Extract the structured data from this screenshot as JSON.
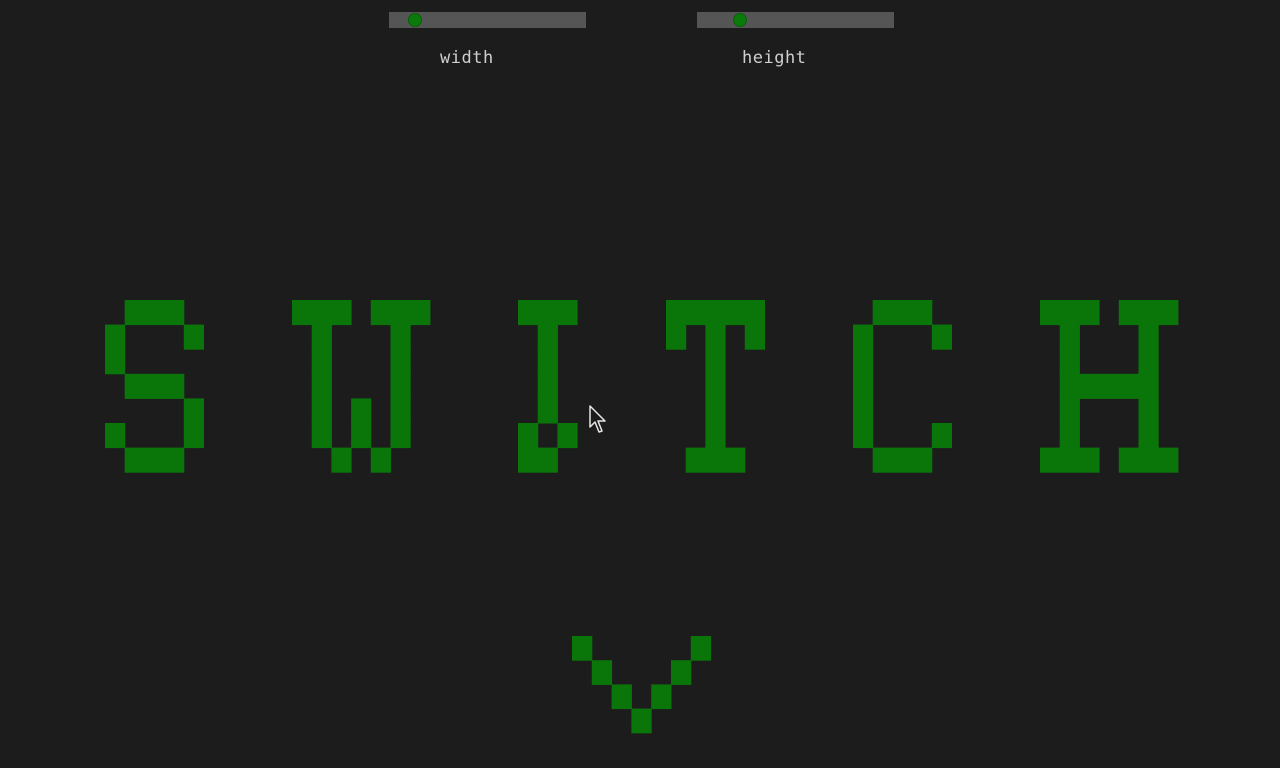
{
  "controls": {
    "width": {
      "label": "width",
      "value_fraction": 0.13
    },
    "height": {
      "label": "height",
      "value_fraction": 0.22
    }
  },
  "display": {
    "text": "SWITCH",
    "pixel_color": "#0a760a",
    "background_color": "#1c1c1c"
  },
  "icons": {
    "down_arrow": "chevron-down-icon",
    "pointer": "mouse-pointer-icon"
  }
}
